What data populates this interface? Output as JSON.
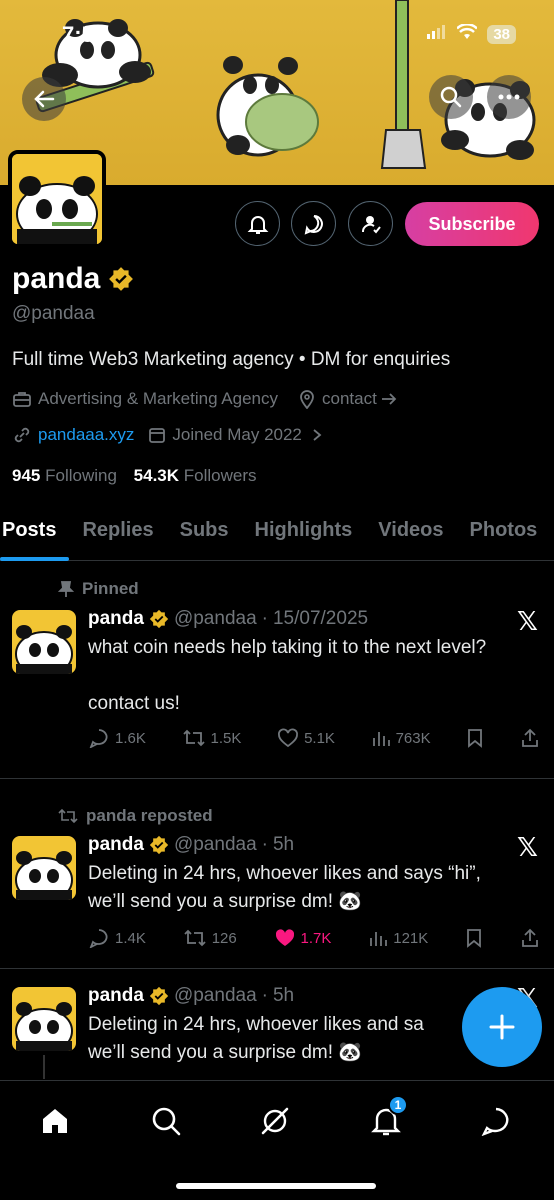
{
  "status_bar": {
    "time": "7:56",
    "battery": "38"
  },
  "profile": {
    "name": "panda",
    "handle": "@pandaa",
    "bio": "Full time Web3 Marketing agency • DM for enquiries",
    "category": "Advertising & Marketing Agency",
    "contact": "contact",
    "website": "pandaaa.xyz",
    "joined": "Joined May 2022",
    "following_count": "945",
    "following_label": "Following",
    "followers_count": "54.3K",
    "followers_label": "Followers",
    "subscribe_label": "Subscribe"
  },
  "tabs": [
    {
      "label": "Posts"
    },
    {
      "label": "Replies"
    },
    {
      "label": "Subs"
    },
    {
      "label": "Highlights"
    },
    {
      "label": "Videos"
    },
    {
      "label": "Photos"
    }
  ],
  "posts": [
    {
      "context": "Pinned",
      "name": "panda",
      "handle": "@pandaa",
      "sep": "·",
      "time": "15/07/2025",
      "text_line1": "what coin needs help taking it to the next level?",
      "text_line2": "contact us!",
      "replies": "1.6K",
      "reposts": "1.5K",
      "likes": "5.1K",
      "views": "763K"
    },
    {
      "context": "panda reposted",
      "name": "panda",
      "handle": "@pandaa",
      "sep": "·",
      "time": "5h",
      "text_line1": "Deleting in 24 hrs, whoever likes and says “hi”,",
      "text_line2": "we’ll send you a surprise dm! 🐼",
      "replies": "1.4K",
      "reposts": "126",
      "likes": "1.7K",
      "views": "121K"
    },
    {
      "name": "panda",
      "handle": "@pandaa",
      "sep": "·",
      "time": "5h",
      "text_line1": "Deleting in 24 hrs, whoever likes and sa",
      "text_line2": "we’ll send you a surprise dm! 🐼"
    }
  ],
  "bottom_nav": {
    "notifications_badge": "1"
  },
  "colors": {
    "accent": "#1d9bf0",
    "like": "#f91880",
    "verified": "#e8b828",
    "banner": "#e3b93c"
  }
}
